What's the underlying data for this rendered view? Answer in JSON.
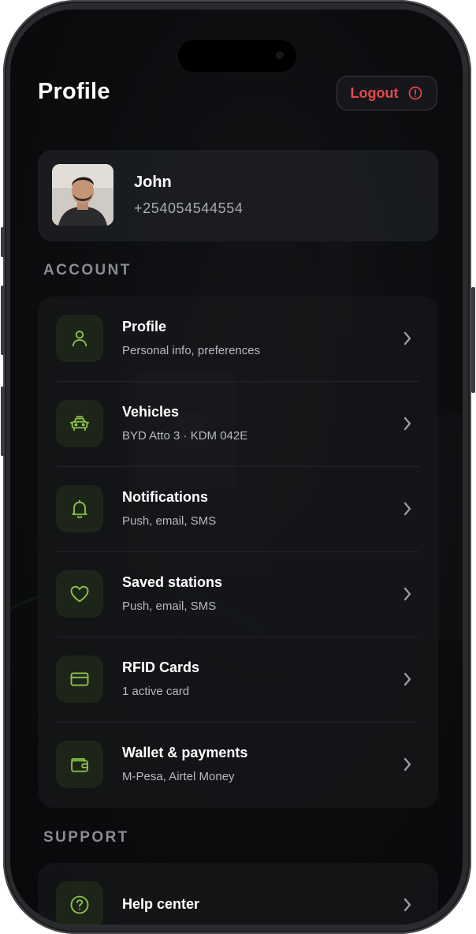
{
  "header": {
    "title": "Profile",
    "logout_label": "Logout"
  },
  "user": {
    "name": "John",
    "phone": "+254054544554"
  },
  "account": {
    "label": "ACCOUNT",
    "items": [
      {
        "title": "Profile",
        "subtitle": "Personal info, preferences",
        "icon": "user-icon"
      },
      {
        "title": "Vehicles",
        "subtitle": "BYD Atto 3 · KDM 042E",
        "icon": "car-icon"
      },
      {
        "title": "Notifications",
        "subtitle": "Push, email, SMS",
        "icon": "bell-icon"
      },
      {
        "title": "Saved stations",
        "subtitle": "Push, email, SMS",
        "icon": "heart-icon"
      },
      {
        "title": "RFID Cards",
        "subtitle": "1 active card",
        "icon": "card-icon"
      },
      {
        "title": "Wallet & payments",
        "subtitle": "M-Pesa, Airtel Money",
        "icon": "wallet-icon"
      }
    ]
  },
  "support": {
    "label": "SUPPORT",
    "items": [
      {
        "title": "Help center",
        "icon": "help-icon"
      }
    ]
  },
  "colors": {
    "accent": "#8bc34a",
    "danger": "#e5484d",
    "background": "#0b0c0e",
    "card": "#16181b"
  }
}
